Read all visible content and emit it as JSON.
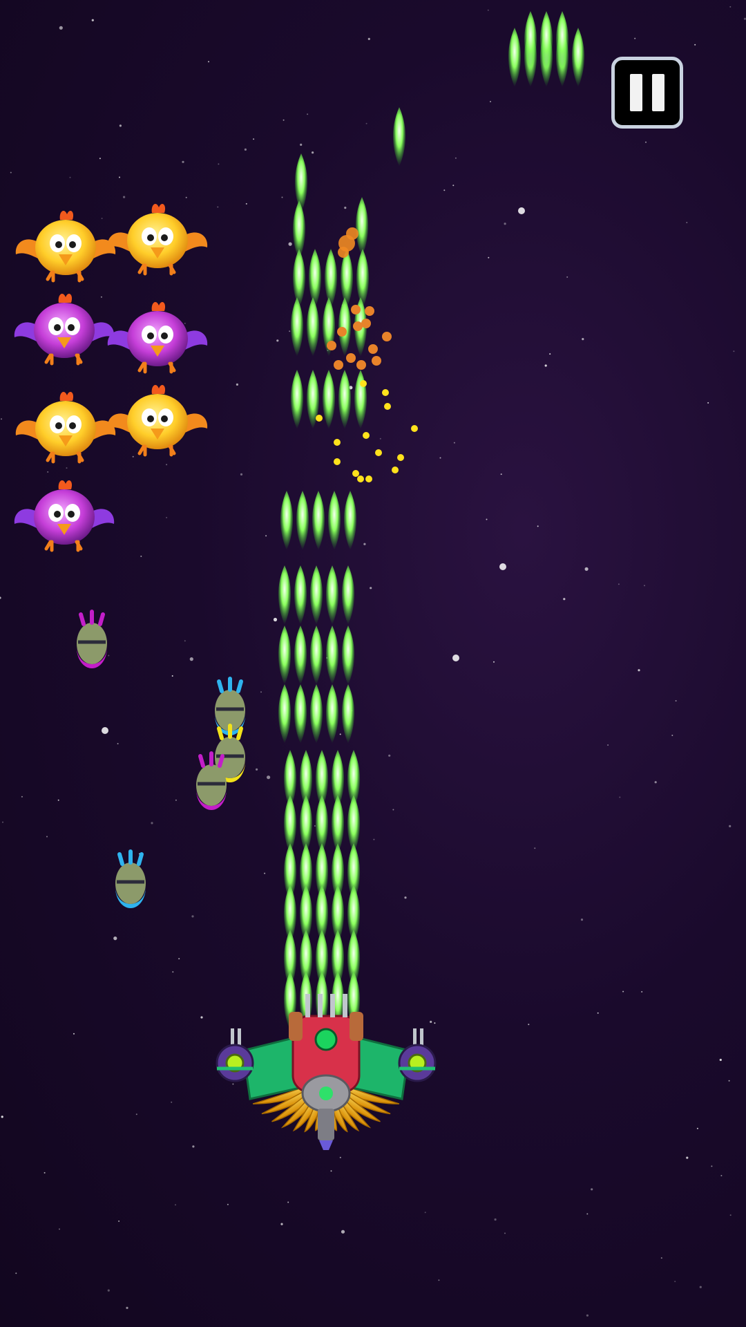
{
  "game": {
    "screen": "in-game",
    "pause_button": {
      "icon": "pause-icon",
      "state": "visible"
    },
    "enemies": [
      {
        "type": "chicken",
        "color": "yellow"
      },
      {
        "type": "chicken",
        "color": "yellow"
      },
      {
        "type": "chicken",
        "color": "purple"
      },
      {
        "type": "chicken",
        "color": "purple"
      },
      {
        "type": "chicken",
        "color": "yellow"
      },
      {
        "type": "chicken",
        "color": "yellow"
      },
      {
        "type": "chicken",
        "color": "purple"
      }
    ],
    "falling_eggs": [
      {
        "color": "magenta"
      },
      {
        "color": "blue"
      },
      {
        "color": "yellow"
      },
      {
        "color": "magenta"
      },
      {
        "color": "blue"
      }
    ],
    "player_ship": {
      "name": "spaceship",
      "weapon": "green-laser"
    },
    "effects": [
      "explosion-orange",
      "explosion-yellow-sparks"
    ]
  },
  "colors": {
    "background": "#160826",
    "laser": "#7cff5a",
    "chicken_yellow": "#ffd23a",
    "chicken_purple": "#c43fd9",
    "ship_red": "#d8314a",
    "ship_gold": "#f4c21a"
  }
}
